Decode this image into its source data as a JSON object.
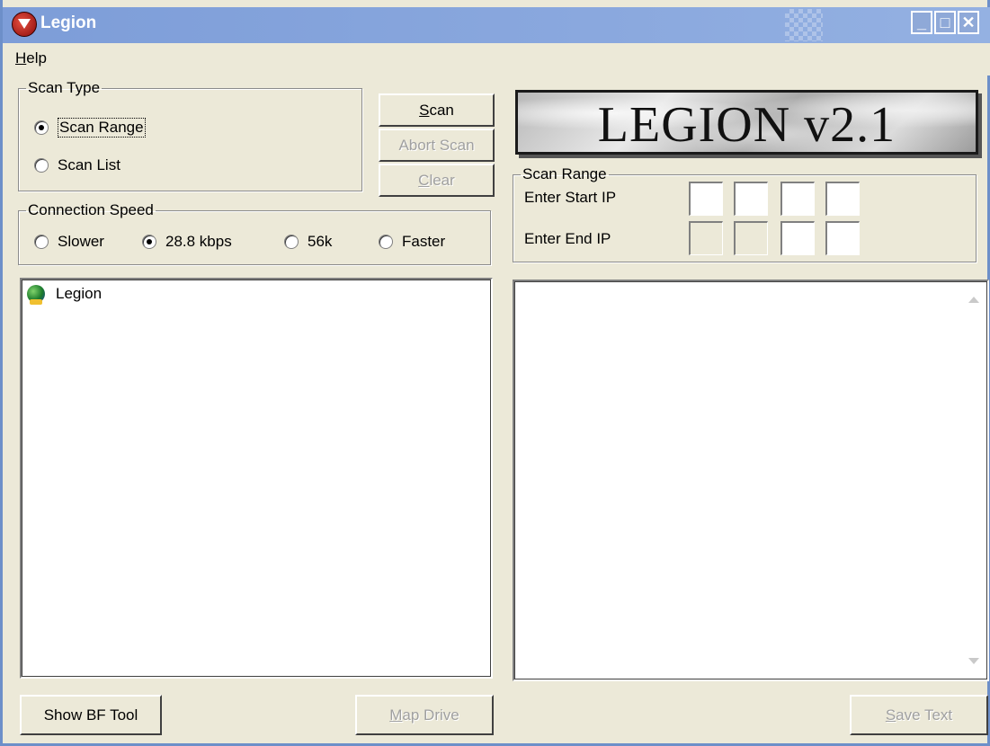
{
  "window": {
    "title": "Legion"
  },
  "menu": {
    "help_rest": "elp",
    "help_mnemonic": "H"
  },
  "scan_type": {
    "legend": "Scan Type",
    "options": [
      {
        "label": "Scan Range",
        "selected": true
      },
      {
        "label": "Scan List",
        "selected": false
      }
    ]
  },
  "buttons": {
    "scan_mnemonic": "S",
    "scan_rest": "can",
    "abort": "Abort Scan",
    "clear_mnemonic": "C",
    "clear_rest": "lear",
    "show_bf": "Show BF Tool",
    "map_mnemonic": "M",
    "map_rest": "ap Drive",
    "save_mnemonic": "S",
    "save_rest": "ave Text"
  },
  "connection_speed": {
    "legend": "Connection Speed",
    "options": [
      {
        "label": "Slower",
        "selected": false
      },
      {
        "label": "28.8 kbps",
        "selected": true
      },
      {
        "label": "56k",
        "selected": false
      },
      {
        "label": "Faster",
        "selected": false
      }
    ]
  },
  "logo": {
    "text": "LEGION v2.1"
  },
  "scan_range": {
    "legend": "Scan Range",
    "start_label": "Enter Start IP",
    "end_label": "Enter End IP",
    "start_ip": [
      "",
      "",
      "",
      ""
    ],
    "end_ip": [
      "",
      "",
      "",
      ""
    ]
  },
  "tree": {
    "root_label": "Legion"
  },
  "output": {
    "text": ""
  }
}
